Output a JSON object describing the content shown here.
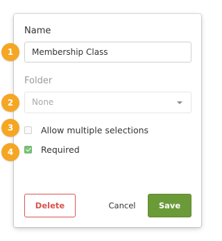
{
  "form": {
    "name_label": "Name",
    "name_value": "Membership Class",
    "folder_label": "Folder",
    "folder_value": "None",
    "allow_multiple_label": "Allow multiple selections",
    "required_label": "Required"
  },
  "checkboxes": {
    "allow_multiple_checked": false,
    "required_checked": true
  },
  "badges": [
    "1",
    "2",
    "3",
    "4"
  ],
  "buttons": {
    "delete": "Delete",
    "cancel": "Cancel",
    "save": "Save"
  },
  "colors": {
    "badge": "#f5a623",
    "save": "#6b9a39",
    "delete": "#d9534f",
    "checkbox_on": "#7cc27a"
  }
}
